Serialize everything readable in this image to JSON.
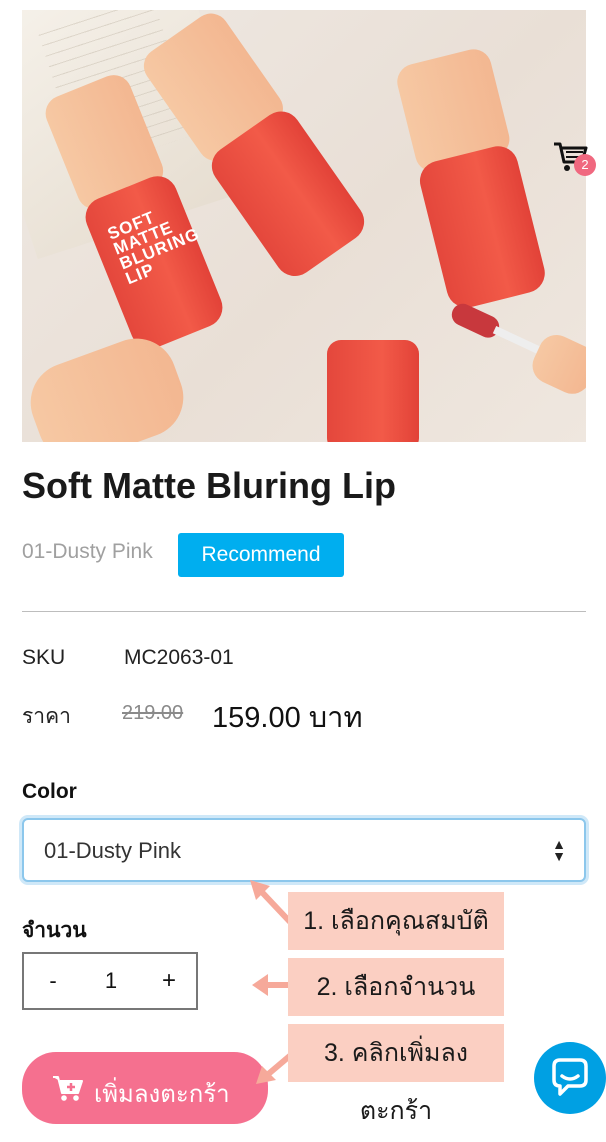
{
  "product": {
    "title": "Soft Matte Bluring Lip",
    "variant": "01-Dusty Pink",
    "badge": "Recommend",
    "image_text": "SOFT MATTE BLURING LIP"
  },
  "cart": {
    "count": "2"
  },
  "details": {
    "sku_label": "SKU",
    "sku_value": "MC2063-01",
    "price_label": "ราคา",
    "old_price": "219.00",
    "new_price": "159.00 บาท"
  },
  "color": {
    "label": "Color",
    "selected": "01-Dusty Pink"
  },
  "quantity": {
    "label": "จำนวน",
    "minus": "-",
    "value": "1",
    "plus": "+"
  },
  "add_to_cart": {
    "label": "เพิ่มลงตะกร้า"
  },
  "annotations": {
    "step1": "1. เลือกคุณสมบัติ",
    "step2": "2. เลือกจำนวน",
    "step3": "3. คลิกเพิ่มลงตะกร้า"
  },
  "colors": {
    "accent": "#00aeef",
    "button": "#f5708f",
    "note_bg": "#fbcfc2",
    "chat": "#00a0e3"
  }
}
